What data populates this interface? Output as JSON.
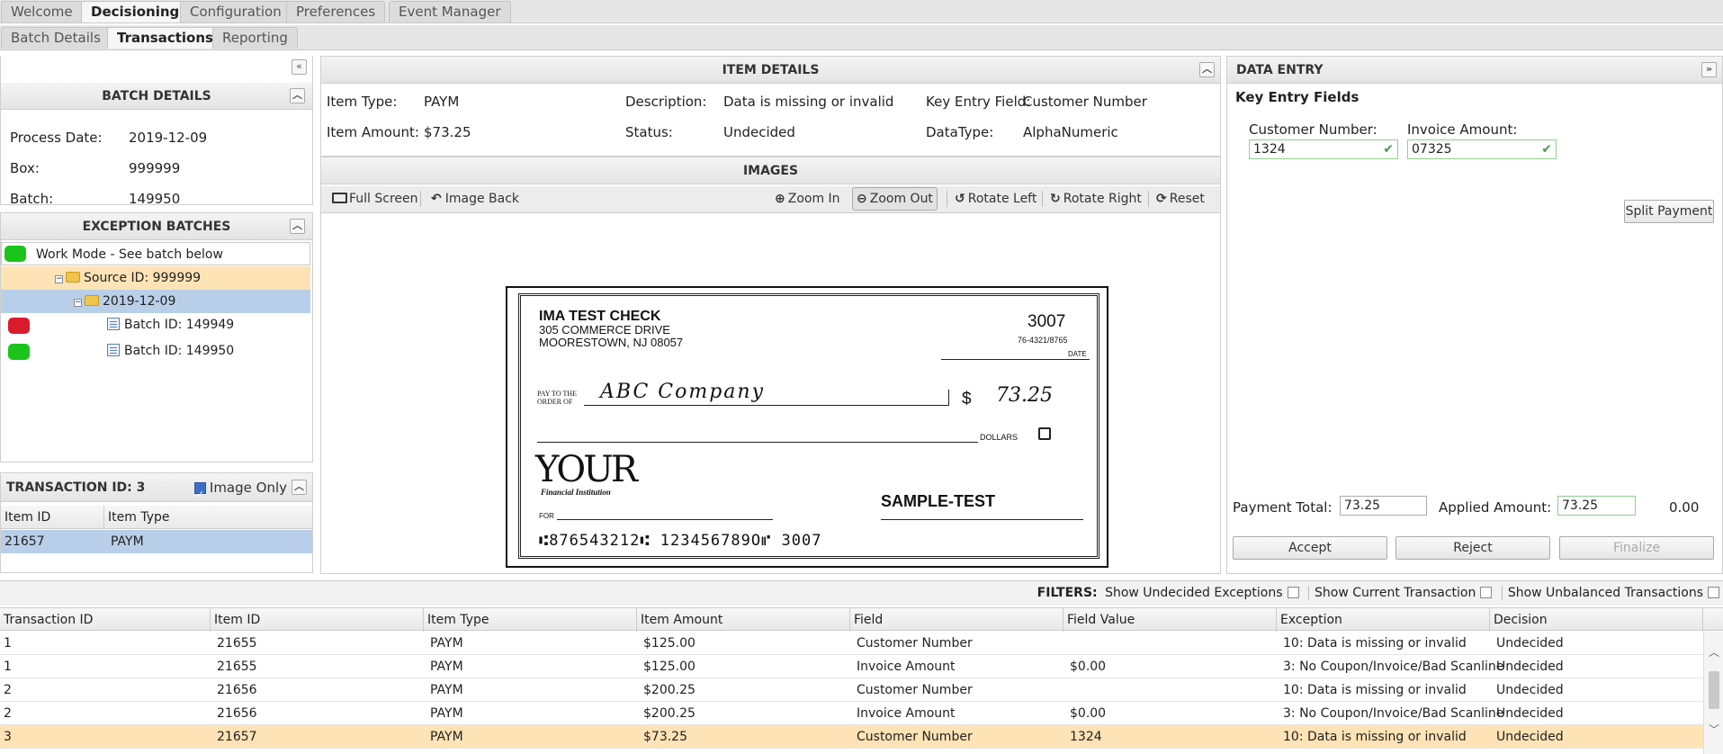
{
  "tabs": [
    "Welcome",
    "Decisioning",
    "Configuration",
    "Preferences",
    "Event Manager"
  ],
  "subtabs": [
    "Batch Details",
    "Transactions",
    "Reporting"
  ],
  "batch_details": {
    "title": "BATCH DETAILS",
    "process_date_label": "Process Date:",
    "process_date": "2019-12-09",
    "box_label": "Box:",
    "box": "999999",
    "batch_label": "Batch:",
    "batch": "149950"
  },
  "exception_batches": {
    "title": "EXCEPTION BATCHES",
    "work_mode": "Work Mode - See batch below",
    "source": "Source ID: 999999",
    "date": "2019-12-09",
    "batches": [
      "Batch ID: 149949",
      "Batch ID: 149950"
    ],
    "status_colors": {
      "green": "#1bc41b",
      "red": "#d81c2c"
    }
  },
  "transaction": {
    "title": "TRANSACTION ID: 3",
    "image_only_label": "Image Only",
    "image_only_checked": true,
    "columns": [
      "Item ID",
      "Item Type"
    ],
    "rows": [
      [
        "21657",
        "PAYM"
      ]
    ]
  },
  "item_details": {
    "title": "ITEM DETAILS",
    "item_type_label": "Item Type:",
    "item_type": "PAYM",
    "description_label": "Description:",
    "description": "Data is missing or invalid",
    "key_entry_label": "Key Entry Field:",
    "key_entry": "Customer Number",
    "item_amount_label": "Item Amount:",
    "item_amount": "$73.25",
    "status_label": "Status:",
    "status": "Undecided",
    "datatype_label": "DataType:",
    "datatype": "AlphaNumeric"
  },
  "images": {
    "title": "IMAGES",
    "toolbar": {
      "full_screen": "Full Screen",
      "image_back": "Image Back",
      "zoom_in": "Zoom In",
      "zoom_out": "Zoom Out",
      "rotate_left": "Rotate Left",
      "rotate_right": "Rotate Right",
      "reset": "Reset"
    },
    "check": {
      "name": "IMA TEST CHECK",
      "address1": "305 COMMERCE DRIVE",
      "address2": "MOORESTOWN, NJ  08057",
      "number": "3007",
      "routing_small": "76-4321/8765",
      "date_label": "DATE",
      "pay_to_line1": "PAY TO THE",
      "pay_to_line2": "ORDER OF",
      "payee": "ABC   Company",
      "dollar_sign": "$",
      "amount": "73.25",
      "dollars_label": "DOLLARS",
      "bank_logo": "YOUR",
      "bank_sub": "Financial Institution",
      "memo_label": "FOR",
      "sample": "SAMPLE-TEST",
      "micr": "⑆876543212⑆  123456789O⑈  3007"
    }
  },
  "data_entry": {
    "title": "DATA ENTRY",
    "section": "Key Entry Fields",
    "customer_number_label": "Customer Number:",
    "customer_number": "1324",
    "invoice_amount_label": "Invoice Amount:",
    "invoice_amount": "07325",
    "split_payment": "Split Payment",
    "payment_total_label": "Payment Total:",
    "payment_total": "73.25",
    "applied_amount_label": "Applied Amount:",
    "applied_amount": "73.25",
    "difference": "0.00",
    "accept": "Accept",
    "reject": "Reject",
    "finalize": "Finalize"
  },
  "filters": {
    "label": "FILTERS:",
    "undecided": "Show Undecided Exceptions",
    "current": "Show Current Transaction",
    "unbalanced": "Show Unbalanced Transactions"
  },
  "grid": {
    "columns": [
      "Transaction ID",
      "Item ID",
      "Item Type",
      "Item Amount",
      "Field",
      "Field Value",
      "Exception",
      "Decision"
    ],
    "rows": [
      [
        "1",
        "21655",
        "PAYM",
        "$125.00",
        "Customer Number",
        "",
        "10: Data is missing or invalid",
        "Undecided"
      ],
      [
        "1",
        "21655",
        "PAYM",
        "$125.00",
        "Invoice Amount",
        "$0.00",
        "3: No Coupon/Invoice/Bad Scanline",
        "Undecided"
      ],
      [
        "2",
        "21656",
        "PAYM",
        "$200.25",
        "Customer Number",
        "",
        "10: Data is missing or invalid",
        "Undecided"
      ],
      [
        "2",
        "21656",
        "PAYM",
        "$200.25",
        "Invoice Amount",
        "$0.00",
        "3: No Coupon/Invoice/Bad Scanline",
        "Undecided"
      ],
      [
        "3",
        "21657",
        "PAYM",
        "$73.25",
        "Customer Number",
        "1324",
        "10: Data is missing or invalid",
        "Undecided"
      ]
    ],
    "selected_row": 4,
    "selected_color": "#fde3b5"
  }
}
